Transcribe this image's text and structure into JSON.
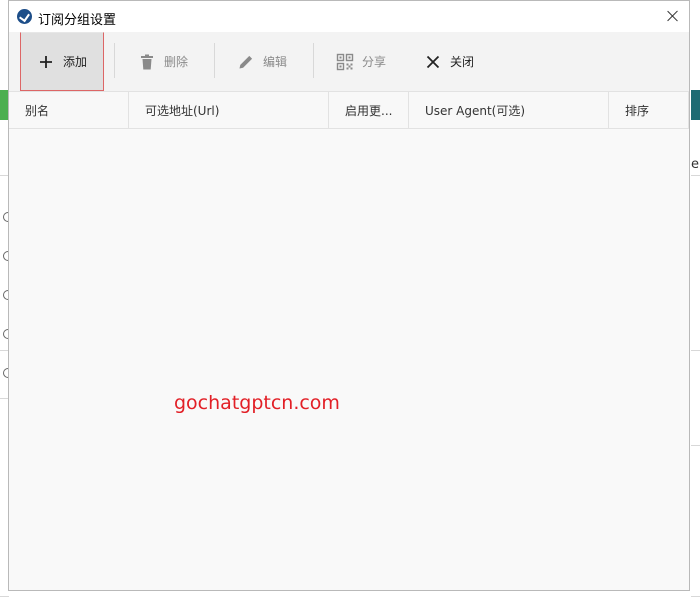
{
  "window": {
    "title": "订阅分组设置"
  },
  "toolbar": {
    "add_label": "添加",
    "delete_label": "删除",
    "edit_label": "编辑",
    "share_label": "分享",
    "close_label": "关闭"
  },
  "grid": {
    "columns": [
      "别名",
      "可选地址(Url)",
      "启用更...",
      "User Agent(可选)",
      "排序"
    ]
  },
  "background": {
    "right_peek_text": "e"
  },
  "watermark": "gochatgptcn.com",
  "colors": {
    "accent_green": "#4caf50",
    "logo_blue": "#1d4e89",
    "watermark_red": "#e21f26",
    "focus_border": "#dd6666"
  },
  "icons": [
    "app-logo-icon",
    "close-icon",
    "plus-icon",
    "trash-icon",
    "pencil-icon",
    "qr-code-icon",
    "x-icon"
  ]
}
